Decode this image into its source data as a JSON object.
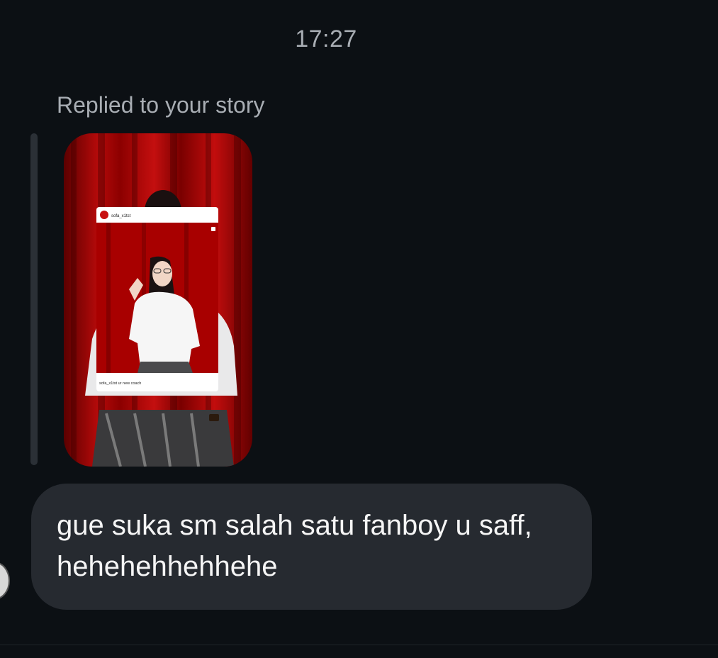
{
  "chat": {
    "timestamp": "17:27",
    "reply_label": "Replied to your story",
    "story_preview": {
      "post_username": "sofa_x1tst",
      "post_caption": "sofa_x1tst ur new coach"
    },
    "message": {
      "text": "gue suka sm salah satu fanboy u saff, hehehehhehhehe"
    }
  },
  "colors": {
    "background": "#0c1014",
    "bubble": "#262a30",
    "muted_text": "#a8adb3",
    "curtain_red": "#b50a0a"
  }
}
